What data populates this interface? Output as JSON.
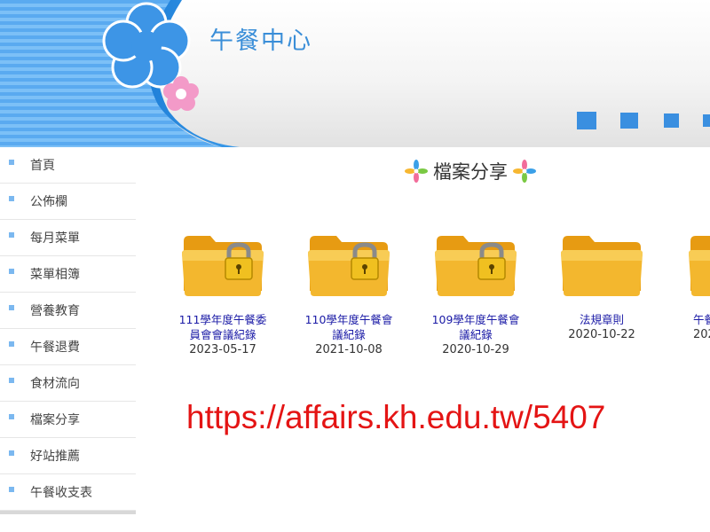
{
  "header": {
    "site_title": "午餐中心"
  },
  "sidebar": {
    "items": [
      {
        "label": "首頁"
      },
      {
        "label": "公佈欄"
      },
      {
        "label": "每月菜單"
      },
      {
        "label": "菜單相簿"
      },
      {
        "label": "營養教育"
      },
      {
        "label": "午餐退費"
      },
      {
        "label": "食材流向"
      },
      {
        "label": "檔案分享"
      },
      {
        "label": "好站推薦"
      },
      {
        "label": "午餐收支表"
      }
    ]
  },
  "main": {
    "heading": "檔案分享",
    "folders": [
      {
        "name_line1": "111學年度午餐委",
        "name_line2": "員會會議紀錄",
        "date": "2023-05-17",
        "locked": true
      },
      {
        "name_line1": "110學年度午餐會",
        "name_line2": "議紀錄",
        "date": "2021-10-08",
        "locked": true
      },
      {
        "name_line1": "109學年度午餐會",
        "name_line2": "議紀錄",
        "date": "2020-10-29",
        "locked": true
      },
      {
        "name_line1": "法規章則",
        "name_line2": "",
        "date": "2020-10-22",
        "locked": false
      },
      {
        "name_line1": "午餐",
        "name_line2": "",
        "date": "202",
        "locked": false
      }
    ],
    "url": "https://affairs.kh.edu.tw/5407"
  },
  "colors": {
    "accent": "#3a8ed8",
    "link": "#1a1aa6",
    "url": "#e41414",
    "folder": "#f3b72e"
  }
}
